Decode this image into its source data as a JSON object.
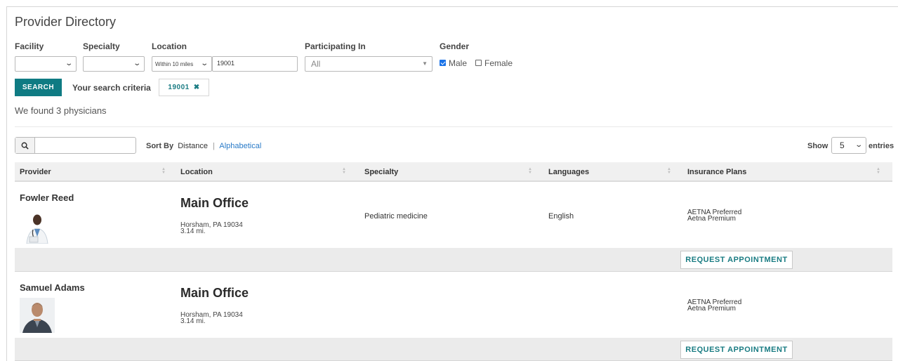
{
  "page": {
    "title": "Provider Directory"
  },
  "filters": {
    "facility": {
      "label": "Facility",
      "value": ""
    },
    "specialty": {
      "label": "Specialty",
      "value": ""
    },
    "location": {
      "label": "Location",
      "radius": "Within 10 miles",
      "zip": "19001"
    },
    "participating": {
      "label": "Participating In",
      "value": "All"
    },
    "gender": {
      "label": "Gender",
      "options": [
        {
          "label": "Male",
          "checked": true
        },
        {
          "label": "Female",
          "checked": false
        }
      ]
    }
  },
  "search": {
    "button_label": "SEARCH",
    "criteria_label": "Your search criteria",
    "chip": "19001",
    "chip_remove": "✖"
  },
  "results": {
    "count_text": "We found 3 physicians"
  },
  "toolbar": {
    "search_placeholder": "",
    "sort_label": "Sort By",
    "sort_options": [
      "Distance",
      "Alphabetical"
    ],
    "sort_separator": "|",
    "show_label": "Show",
    "entries_value": "5",
    "entries_label": "entries"
  },
  "table": {
    "columns": [
      "Provider",
      "Location",
      "Specialty",
      "Languages",
      "Insurance Plans"
    ],
    "rows": [
      {
        "name": "Fowler Reed",
        "office": "Main Office",
        "city": "Horsham, PA 19034",
        "distance": "3.14 mi.",
        "specialty": "Pediatric medicine",
        "language": "English",
        "plans": [
          "AETNA Preferred",
          "Aetna Premium"
        ],
        "action": "REQUEST APPOINTMENT"
      },
      {
        "name": "Samuel Adams",
        "office": "Main Office",
        "city": "Horsham, PA 19034",
        "distance": "3.14 mi.",
        "specialty": "",
        "language": "",
        "plans": [
          "AETNA Preferred",
          "Aetna Premium"
        ],
        "action": "REQUEST APPOINTMENT"
      }
    ]
  },
  "colors": {
    "accent": "#0f7b83",
    "link": "#2a7bc8",
    "row_action_bg": "#ebebeb"
  }
}
